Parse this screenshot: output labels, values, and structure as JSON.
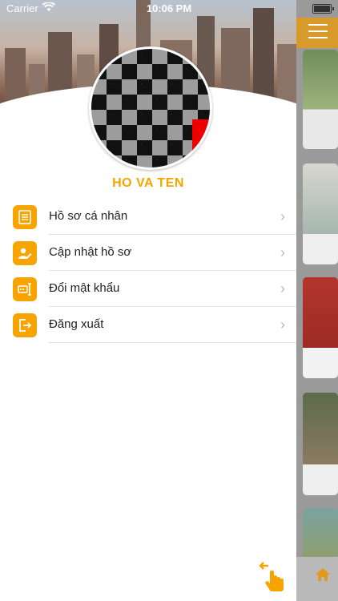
{
  "status_bar": {
    "carrier": "Carrier",
    "time": "10:06 PM"
  },
  "profile": {
    "name": "HO VA TEN"
  },
  "menu": [
    {
      "label": "Hồ sơ cá nhân",
      "icon": "profile-document-icon"
    },
    {
      "label": "Cập nhật hồ sơ",
      "icon": "edit-user-icon"
    },
    {
      "label": "Đổi mật khẩu",
      "icon": "password-key-icon"
    },
    {
      "label": "Đăng xuất",
      "icon": "logout-icon"
    }
  ],
  "colors": {
    "accent": "#f7a400",
    "topbar": "#d99a2c"
  }
}
